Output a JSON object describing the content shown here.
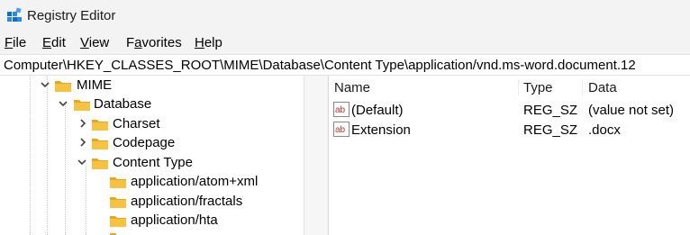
{
  "window": {
    "title": "Registry Editor",
    "icon": "registry-editor-icon"
  },
  "menu": [
    {
      "key": "F",
      "rest": "ile"
    },
    {
      "key": "E",
      "rest": "dit"
    },
    {
      "key": "V",
      "rest": "iew"
    },
    {
      "pre": "F",
      "key": "a",
      "rest": "vorites"
    },
    {
      "key": "H",
      "rest": "elp"
    }
  ],
  "address": "Computer\\HKEY_CLASSES_ROOT\\MIME\\Database\\Content Type\\application/vnd.ms-word.document.12",
  "tree": [
    {
      "label": "MIME",
      "state": "expanded"
    },
    {
      "label": "Database",
      "state": "expanded"
    },
    {
      "label": "Charset",
      "state": "collapsed"
    },
    {
      "label": "Codepage",
      "state": "collapsed"
    },
    {
      "label": "Content Type",
      "state": "expanded"
    },
    {
      "label": "application/atom+xml",
      "state": "leaf"
    },
    {
      "label": "application/fractals",
      "state": "leaf"
    },
    {
      "label": "application/hta",
      "state": "leaf"
    }
  ],
  "columns": {
    "name": "Name",
    "type": "Type",
    "data": "Data"
  },
  "values": [
    {
      "name": "(Default)",
      "type": "REG_SZ",
      "data": "(value not set)",
      "icon": "string-value-icon"
    },
    {
      "name": "Extension",
      "type": "REG_SZ",
      "data": ".docx",
      "icon": "string-value-icon"
    }
  ],
  "colors": {
    "folder": "#f5c242",
    "folder_dark": "#e0a91f",
    "accent": "#0078d4",
    "ab_red": "#c0312b"
  }
}
